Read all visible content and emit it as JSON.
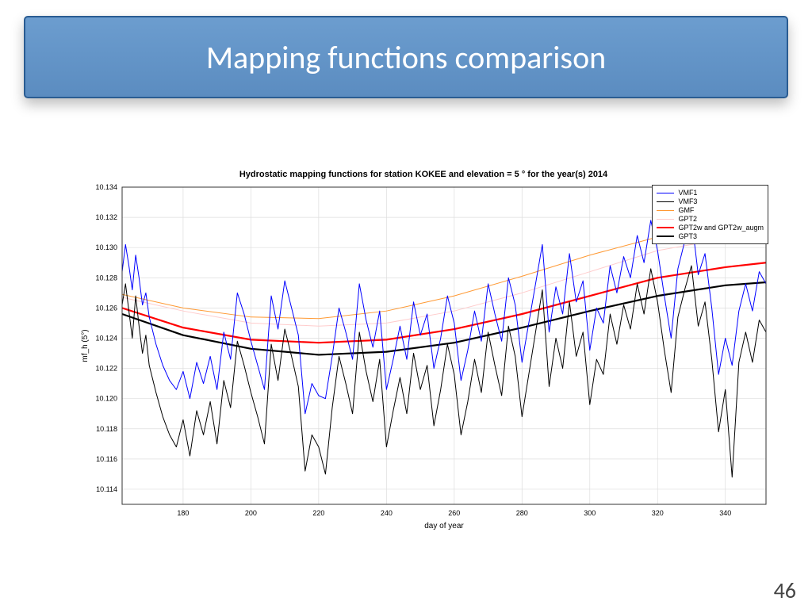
{
  "title": "Mapping functions comparison",
  "slide_number": "46",
  "chart_data": {
    "type": "line",
    "title": "Hydrostatic mapping functions for station KOKEE and elevation = 5 ° for the year(s) 2014",
    "xlabel": "day of year",
    "ylabel": "mf_h (5°)",
    "xlim": [
      162,
      352
    ],
    "ylim": [
      10.113,
      10.134
    ],
    "xticks": [
      180,
      200,
      220,
      240,
      260,
      280,
      300,
      320,
      340
    ],
    "yticks": [
      10.114,
      10.116,
      10.118,
      10.12,
      10.122,
      10.124,
      10.126,
      10.128,
      10.13,
      10.132,
      10.134
    ],
    "legend": [
      {
        "name": "VMF1",
        "color": "#0000ff",
        "width": 1
      },
      {
        "name": "VMF3",
        "color": "#000000",
        "width": 1
      },
      {
        "name": "GMF",
        "color": "#ff9933",
        "width": 1
      },
      {
        "name": "GPT2",
        "color": "#ffcccc",
        "width": 1
      },
      {
        "name": "GPT2w and GPT2w_augm",
        "color": "#ff0000",
        "width": 2.2
      },
      {
        "name": "GPT3",
        "color": "#000000",
        "width": 2.2
      }
    ],
    "series": [
      {
        "name": "GPT2",
        "color": "#ffcccc",
        "width": 1,
        "x": [
          162,
          180,
          200,
          220,
          240,
          260,
          280,
          300,
          320,
          340,
          352
        ],
        "y": [
          10.1267,
          10.1258,
          10.125,
          10.1248,
          10.125,
          10.1258,
          10.127,
          10.1284,
          10.1298,
          10.1306,
          10.1308
        ]
      },
      {
        "name": "GMF",
        "color": "#ff9933",
        "width": 1,
        "x": [
          162,
          180,
          200,
          220,
          240,
          260,
          280,
          300,
          320,
          340,
          352
        ],
        "y": [
          10.1269,
          10.126,
          10.1254,
          10.1253,
          10.1258,
          10.1268,
          10.1281,
          10.1295,
          10.1307,
          10.1314,
          10.1316
        ]
      },
      {
        "name": "GPT2w and GPT2w_augm",
        "color": "#ff0000",
        "width": 2.2,
        "x": [
          162,
          180,
          200,
          220,
          240,
          260,
          280,
          300,
          320,
          340,
          352
        ],
        "y": [
          10.126,
          10.1247,
          10.1239,
          10.1237,
          10.1239,
          10.1246,
          10.1256,
          10.1268,
          10.128,
          10.1287,
          10.129
        ]
      },
      {
        "name": "GPT3",
        "color": "#000000",
        "width": 2.2,
        "x": [
          162,
          180,
          200,
          220,
          240,
          260,
          280,
          300,
          320,
          340,
          352
        ],
        "y": [
          10.1256,
          10.1242,
          10.1233,
          10.1229,
          10.1231,
          10.1237,
          10.1247,
          10.1258,
          10.1268,
          10.1275,
          10.1277
        ]
      },
      {
        "name": "VMF1",
        "color": "#0000ff",
        "width": 1,
        "x": [
          162,
          163,
          164,
          165,
          166,
          167,
          168,
          169,
          170,
          172,
          174,
          176,
          178,
          180,
          182,
          184,
          186,
          188,
          190,
          192,
          194,
          196,
          198,
          200,
          202,
          204,
          206,
          208,
          210,
          212,
          214,
          216,
          218,
          220,
          222,
          224,
          226,
          228,
          230,
          232,
          234,
          236,
          238,
          240,
          242,
          244,
          246,
          248,
          250,
          252,
          254,
          256,
          258,
          260,
          262,
          264,
          266,
          268,
          270,
          272,
          274,
          276,
          278,
          280,
          282,
          284,
          286,
          288,
          290,
          292,
          294,
          296,
          298,
          300,
          302,
          304,
          306,
          308,
          310,
          312,
          314,
          316,
          318,
          320,
          322,
          324,
          326,
          328,
          330,
          332,
          334,
          336,
          338,
          340,
          342,
          344,
          346,
          348,
          350,
          352
        ],
        "y": [
          10.1284,
          10.1302,
          10.1288,
          10.1272,
          10.1295,
          10.128,
          10.1262,
          10.127,
          10.1254,
          10.1236,
          10.1222,
          10.1212,
          10.1206,
          10.1218,
          10.12,
          10.1224,
          10.121,
          10.1228,
          10.1206,
          10.1244,
          10.1226,
          10.127,
          10.1256,
          10.1238,
          10.1222,
          10.1206,
          10.1268,
          10.1246,
          10.1278,
          10.126,
          10.1242,
          10.119,
          10.121,
          10.1202,
          10.12,
          10.1228,
          10.126,
          10.1244,
          10.1226,
          10.1276,
          10.1252,
          10.1234,
          10.1258,
          10.1206,
          10.1226,
          10.1248,
          10.1226,
          10.1264,
          10.1242,
          10.1256,
          10.122,
          10.124,
          10.1268,
          10.125,
          10.1212,
          10.1232,
          10.1258,
          10.1238,
          10.1276,
          10.1256,
          10.1238,
          10.128,
          10.1262,
          10.1224,
          10.125,
          10.1276,
          10.1302,
          10.1244,
          10.1274,
          10.1256,
          10.1296,
          10.1264,
          10.1278,
          10.1232,
          10.126,
          10.125,
          10.1288,
          10.127,
          10.1294,
          10.128,
          10.1308,
          10.129,
          10.1318,
          10.1298,
          10.1268,
          10.124,
          10.1286,
          10.1304,
          10.132,
          10.1282,
          10.1296,
          10.126,
          10.1216,
          10.124,
          10.1222,
          10.1258,
          10.1276,
          10.1258,
          10.1284,
          10.1276
        ]
      },
      {
        "name": "VMF3",
        "color": "#000000",
        "width": 1,
        "x": [
          162,
          163,
          164,
          165,
          166,
          167,
          168,
          169,
          170,
          172,
          174,
          176,
          178,
          180,
          182,
          184,
          186,
          188,
          190,
          192,
          194,
          196,
          198,
          200,
          202,
          204,
          206,
          208,
          210,
          212,
          214,
          216,
          218,
          220,
          222,
          224,
          226,
          228,
          230,
          232,
          234,
          236,
          238,
          240,
          242,
          244,
          246,
          248,
          250,
          252,
          254,
          256,
          258,
          260,
          262,
          264,
          266,
          268,
          270,
          272,
          274,
          276,
          278,
          280,
          282,
          284,
          286,
          288,
          290,
          292,
          294,
          296,
          298,
          300,
          302,
          304,
          306,
          308,
          310,
          312,
          314,
          316,
          318,
          320,
          322,
          324,
          326,
          328,
          330,
          332,
          334,
          336,
          338,
          340,
          342,
          344,
          346,
          348,
          350,
          352
        ],
        "y": [
          10.1262,
          10.1276,
          10.1258,
          10.124,
          10.1268,
          10.1248,
          10.123,
          10.1242,
          10.1222,
          10.1204,
          10.1188,
          10.1176,
          10.1168,
          10.1186,
          10.1162,
          10.1192,
          10.1176,
          10.1198,
          10.117,
          10.1212,
          10.1194,
          10.1238,
          10.1222,
          10.1204,
          10.1188,
          10.117,
          10.1236,
          10.1212,
          10.1246,
          10.1228,
          10.1208,
          10.1152,
          10.1176,
          10.1168,
          10.115,
          10.1194,
          10.1228,
          10.121,
          10.119,
          10.1244,
          10.1218,
          10.1198,
          10.1226,
          10.1168,
          10.1192,
          10.1214,
          10.119,
          10.123,
          10.1206,
          10.1222,
          10.1182,
          10.1206,
          10.1236,
          10.1216,
          10.1176,
          10.1198,
          10.1226,
          10.1204,
          10.1244,
          10.1222,
          10.1202,
          10.1248,
          10.1228,
          10.1188,
          10.1216,
          10.1244,
          10.1272,
          10.1208,
          10.124,
          10.122,
          10.1264,
          10.1228,
          10.1244,
          10.1196,
          10.1226,
          10.1216,
          10.1256,
          10.1236,
          10.1262,
          10.1246,
          10.1276,
          10.1256,
          10.1286,
          10.1264,
          10.1232,
          10.1204,
          10.1254,
          10.1272,
          10.1288,
          10.1248,
          10.1264,
          10.1226,
          10.1178,
          10.1206,
          10.1148,
          10.1224,
          10.1244,
          10.1224,
          10.1252,
          10.1244
        ]
      }
    ]
  }
}
